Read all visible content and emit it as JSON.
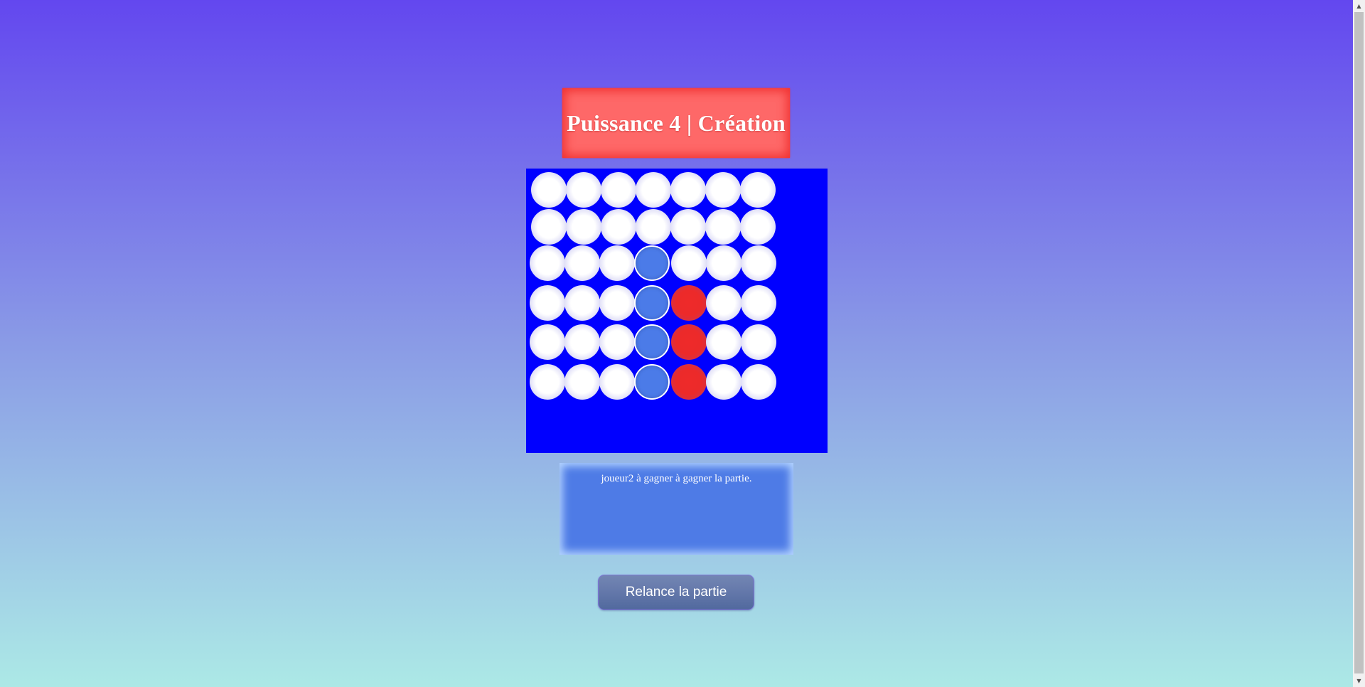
{
  "header": {
    "title": "Puissance 4 | Création"
  },
  "board": {
    "columns": 7,
    "rows": 6,
    "cells": [
      [
        "empty",
        "empty",
        "empty",
        "empty",
        "empty",
        "empty",
        "empty"
      ],
      [
        "empty",
        "empty",
        "empty",
        "empty",
        "empty",
        "empty",
        "empty"
      ],
      [
        "empty",
        "empty",
        "empty",
        "blue",
        "empty",
        "empty",
        "empty"
      ],
      [
        "empty",
        "empty",
        "empty",
        "blue",
        "red",
        "empty",
        "empty"
      ],
      [
        "empty",
        "empty",
        "empty",
        "blue",
        "red",
        "empty",
        "empty"
      ],
      [
        "empty",
        "empty",
        "empty",
        "blue",
        "red",
        "empty",
        "empty"
      ]
    ],
    "colors": {
      "board": "#0000ff",
      "blue_token": "#4b7be8",
      "red_token": "#ee2a2a",
      "empty": "#ffffff"
    }
  },
  "status": {
    "message": "joueur2 à gagner à gagner la partie."
  },
  "controls": {
    "restart_label": "Relance la partie"
  },
  "scrollbar": {
    "up_icon": "▲",
    "down_icon": "▼"
  }
}
